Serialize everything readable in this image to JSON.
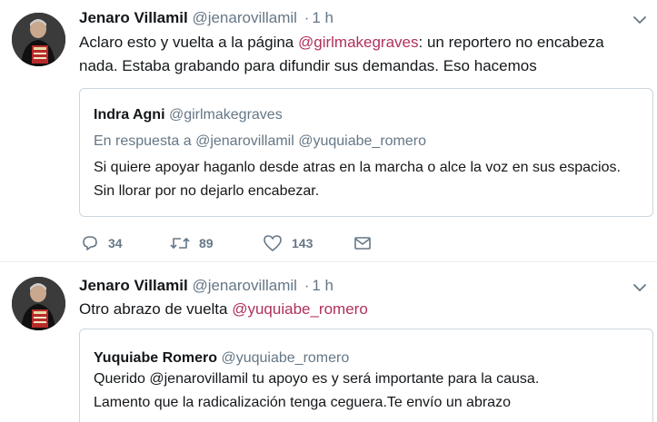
{
  "tweets": [
    {
      "display_name": "Jenaro Villamil",
      "screen_name": "@jenarovillamil",
      "separator": "·",
      "time": "1 h",
      "text_before": "Aclaro esto y vuelta a la página ",
      "mention": "@girlmakegraves",
      "text_after": ": un reportero no encabeza nada. Estaba grabando para difundir sus demandas. Eso hacemos",
      "quote": {
        "display_name": "Indra Agni",
        "screen_name": "@girlmakegraves",
        "reply_to": "En respuesta a @jenarovillamil @yuquiabe_romero",
        "text": "Si quiere apoyar haganlo desde atras en la marcha o alce la voz en sus espacios. Sin llorar por no dejarlo encabezar."
      },
      "actions": {
        "replies": "34",
        "retweets": "89",
        "likes": "143"
      }
    },
    {
      "display_name": "Jenaro Villamil",
      "screen_name": "@jenarovillamil",
      "separator": "·",
      "time": "1 h",
      "text_before": "Otro abrazo de vuelta ",
      "mention": "@yuquiabe_romero",
      "quote": {
        "display_name": "Yuquiabe Romero",
        "screen_name": "@yuquiabe_romero",
        "text_line1": "Querido @jenarovillamil  tu apoyo es y será importante para la causa.",
        "text_line2": "Lamento que la radicalización tenga ceguera.Te envío un abrazo"
      }
    }
  ],
  "icons": {
    "reply": "reply-icon",
    "retweet": "retweet-icon",
    "like": "heart-icon",
    "dm": "envelope-icon",
    "caret": "chevron-down-icon"
  },
  "colors": {
    "mention": "#b0305e",
    "secondary_text": "#657786",
    "divider": "#e6ecf0"
  }
}
